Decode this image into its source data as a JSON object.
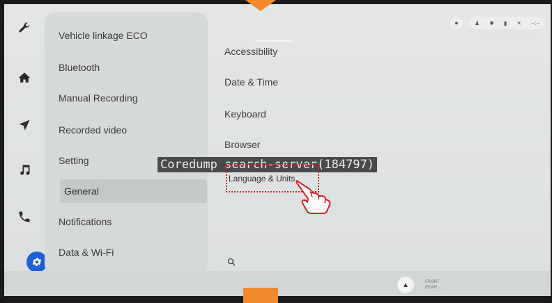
{
  "menu": {
    "items": [
      {
        "label": "Vehicle linkage ECO"
      },
      {
        "label": "Bluetooth"
      },
      {
        "label": "Manual Recording"
      },
      {
        "label": "Recorded video"
      },
      {
        "label": "Setting"
      },
      {
        "label": "General",
        "active": true
      },
      {
        "label": "Notifications"
      },
      {
        "label": "Data & Wi-Fi"
      }
    ]
  },
  "content": {
    "items": [
      {
        "label": "Accessibility"
      },
      {
        "label": "Date & Time"
      },
      {
        "label": "Keyboard"
      },
      {
        "label": "Browser"
      },
      {
        "label": "Language & Units"
      }
    ]
  },
  "overlay": {
    "coredump": "Coredump search-server(184797)"
  },
  "status": {
    "time": "--:--"
  },
  "bottom": {
    "front": "FRONT",
    "rear": "REAR"
  },
  "icons": {
    "rail": [
      "wrench-icon",
      "home-icon",
      "navigation-icon",
      "music-icon",
      "phone-icon",
      "settings-icon"
    ]
  },
  "colors": {
    "accent": "#1c5fd6",
    "highlight_box": "#d92020",
    "marker": "#f28a2d"
  }
}
